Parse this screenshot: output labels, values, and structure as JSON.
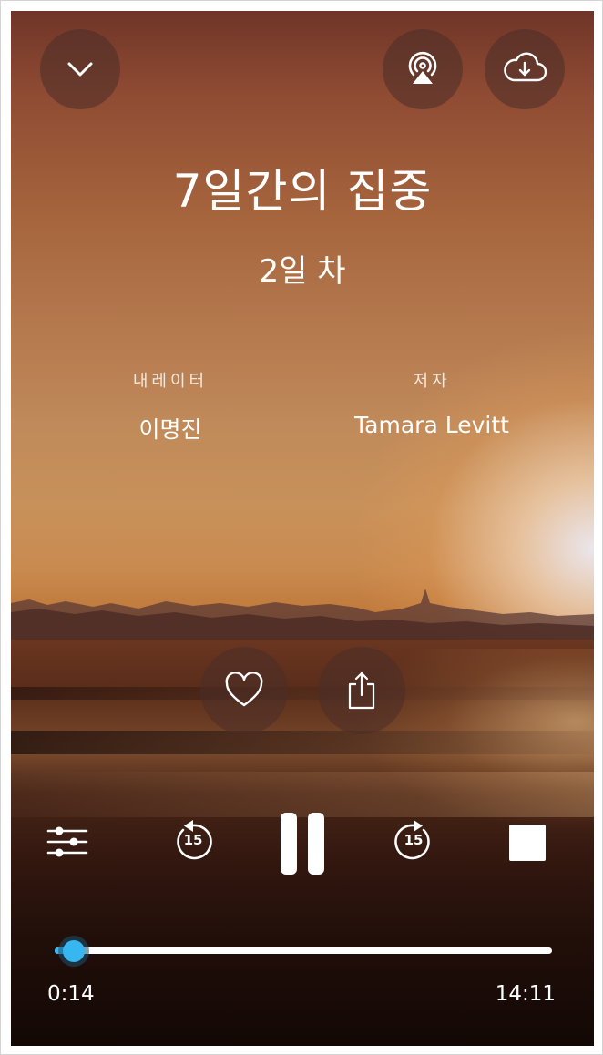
{
  "header": {
    "title": "7일간의 집중",
    "subtitle": "2일 차"
  },
  "credits": {
    "narrator_label": "내레이터",
    "narrator_name": "이명진",
    "author_label": "저자",
    "author_name": "Tamara Levitt"
  },
  "controls": {
    "rewind_seconds": "15",
    "forward_seconds": "15"
  },
  "progress": {
    "elapsed": "0:14",
    "duration": "14:11",
    "fraction": 0.0165
  },
  "colors": {
    "accent": "#38b6f0"
  }
}
